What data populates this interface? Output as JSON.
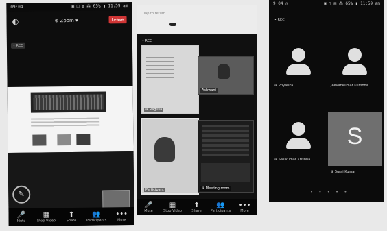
{
  "phone1": {
    "status_left": "09:04",
    "status_right": "▣ ◫ ▤ ⁂ 65% ▮ 11:59 am",
    "leave_label": "Leave",
    "meeting_title": "⊕ Zoom ▾",
    "meeting_badge": "• REC",
    "toolbar": [
      {
        "glyph": "🎤",
        "label": "Mute"
      },
      {
        "glyph": "▦",
        "label": "Stop Video"
      },
      {
        "glyph": "⬆",
        "label": "Share"
      },
      {
        "glyph": "👥",
        "label": "Participants"
      },
      {
        "glyph": "•••",
        "label": "More"
      }
    ]
  },
  "phone2": {
    "header_title": "Tap to return",
    "badge": "• REC",
    "tiles": [
      {
        "name": "⊕ Ragusa"
      },
      {
        "name": "Ashwani"
      },
      {
        "name": "Participant"
      },
      {
        "name": "⊕ Meeting room"
      }
    ],
    "toolbar": [
      {
        "glyph": "🎤",
        "label": "Mute"
      },
      {
        "glyph": "▦",
        "label": "Stop Video"
      },
      {
        "glyph": "⬆",
        "label": "Share"
      },
      {
        "glyph": "👥",
        "label": "Participants"
      },
      {
        "glyph": "•••",
        "label": "More"
      }
    ]
  },
  "phone3": {
    "status_left": "9:04 ◔",
    "status_right": "▣ ◫ ▤ ⁂ 65% ▮ 11:59 am",
    "badge": "• REC",
    "participants": [
      {
        "name": "⊕ Priyanka"
      },
      {
        "name": "Jeevankumar Kumbha..."
      },
      {
        "name": "⊕ Sasikumar Krishna"
      },
      {
        "name": "⊕ Suraj Kumar",
        "letter": "S"
      }
    ],
    "page_dots": "• • • • •"
  }
}
